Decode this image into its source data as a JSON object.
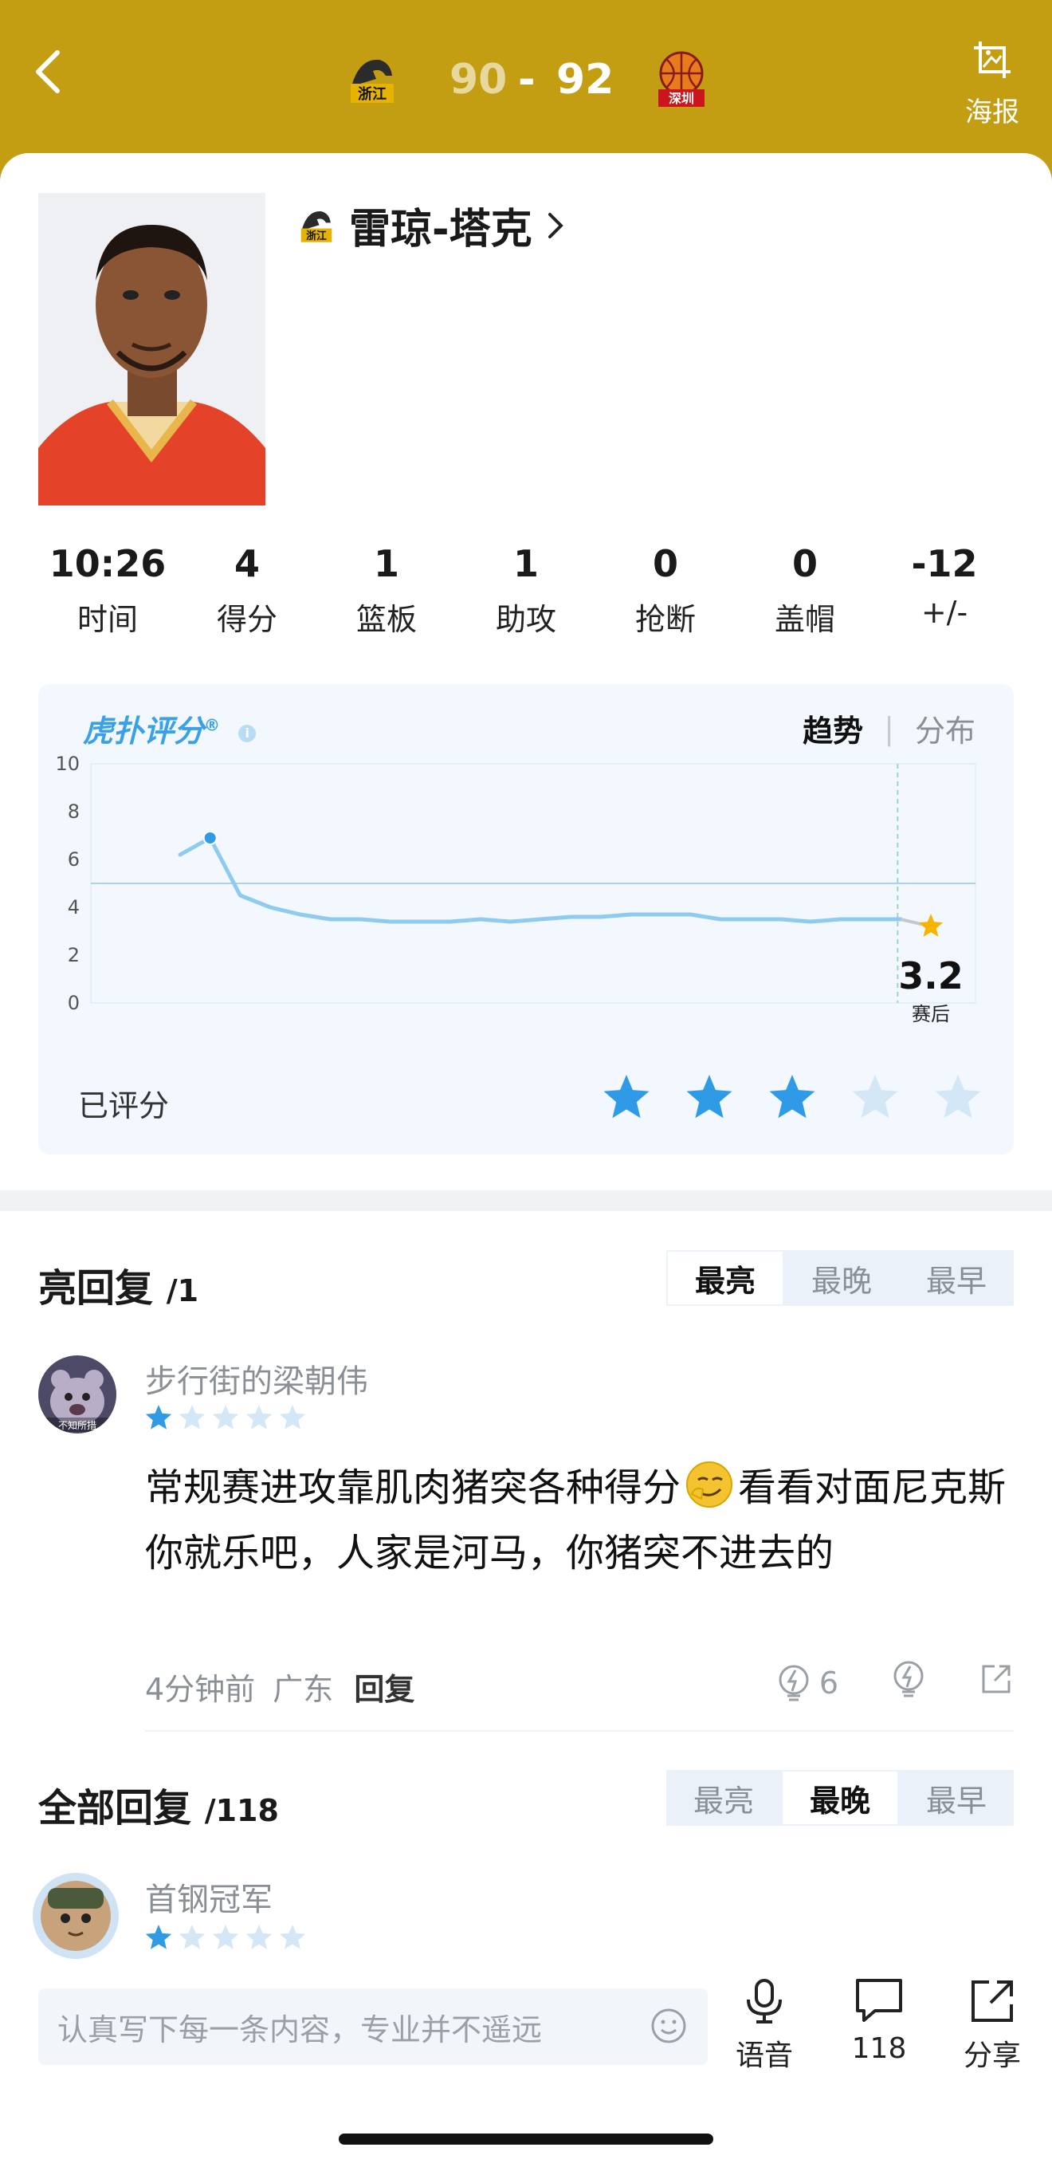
{
  "header": {
    "home_score": "90",
    "separator": "-",
    "away_score": "92",
    "poster_label": "海报",
    "home_team_logo_text": "浙江",
    "away_team_logo_text": "深圳",
    "background_color": "#c39e12"
  },
  "player": {
    "name": "雷琼-塔克",
    "team_logo_text": "浙江"
  },
  "stats": [
    {
      "value": "10:26",
      "label": "时间"
    },
    {
      "value": "4",
      "label": "得分"
    },
    {
      "value": "1",
      "label": "篮板"
    },
    {
      "value": "1",
      "label": "助攻"
    },
    {
      "value": "0",
      "label": "抢断"
    },
    {
      "value": "0",
      "label": "盖帽"
    },
    {
      "value": "-12",
      "label": "+/-"
    }
  ],
  "rating": {
    "brand": "虎扑评分",
    "tab_trend": "趋势",
    "tab_distribution": "分布",
    "final_score": "3.2",
    "final_label": "赛后",
    "rated_label": "已评分",
    "my_stars": 3,
    "max_stars": 5,
    "accent_color": "#2f9be6"
  },
  "chart_data": {
    "type": "line",
    "y_ticks": [
      "10",
      "8",
      "6",
      "4",
      "2",
      "0"
    ],
    "ylim": [
      0,
      10
    ],
    "reference_line": 5,
    "series": [
      {
        "values": [
          6.2,
          6.9,
          4.5,
          4.0,
          3.7,
          3.5,
          3.5,
          3.4,
          3.4,
          3.4,
          3.5,
          3.4,
          3.5,
          3.6,
          3.6,
          3.7,
          3.7,
          3.7,
          3.5,
          3.5,
          3.5,
          3.4,
          3.5,
          3.5,
          3.5,
          3.2
        ],
        "highlight_index": 1,
        "final_value": 3.2
      }
    ]
  },
  "highlight_replies": {
    "title": "亮回复",
    "count": "/1",
    "sort_tabs": [
      "最亮",
      "最晚",
      "最早"
    ],
    "active_tab": 0
  },
  "comment": {
    "username": "步行街的梁朝伟",
    "avatar_caption": "不知所措",
    "stars": 1,
    "text_part1": "常规赛进攻靠肌肉猪突各种得分",
    "text_part2": "看看对面尼克斯你就乐吧，人家是河马，你猪突不进去的",
    "time": "4分钟前",
    "location": "广东",
    "reply_label": "回复",
    "light_count": "6"
  },
  "all_replies": {
    "title": "全部回复",
    "count": "/118",
    "sort_tabs": [
      "最亮",
      "最晚",
      "最早"
    ],
    "active_tab": 1
  },
  "comment2": {
    "username": "首钢冠军",
    "stars": 1
  },
  "bottom_bar": {
    "input_placeholder": "认真写下每一条内容，专业并不遥远",
    "voice_label": "语音",
    "comment_count": "118",
    "share_label": "分享"
  }
}
